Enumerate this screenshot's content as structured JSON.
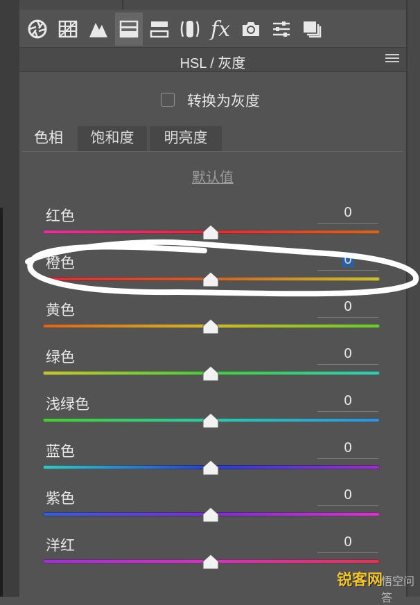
{
  "header": {
    "title": "HSL / 灰度"
  },
  "toolbar": {
    "tools": [
      {
        "icon": "aperture-icon"
      },
      {
        "icon": "grid-icon"
      },
      {
        "icon": "mountain-icon"
      },
      {
        "icon": "hsl-icon",
        "active": true
      },
      {
        "icon": "split-tone-icon"
      },
      {
        "icon": "lens-icon"
      },
      {
        "icon": "fx-icon",
        "label": "fx"
      },
      {
        "icon": "camera-icon"
      },
      {
        "icon": "sliders-icon"
      },
      {
        "icon": "presets-icon"
      }
    ]
  },
  "grayscale": {
    "label": "转换为灰度",
    "checked": false
  },
  "tabs": [
    {
      "label": "色相",
      "active": true
    },
    {
      "label": "饱和度",
      "active": false
    },
    {
      "label": "明亮度",
      "active": false
    }
  ],
  "default_link": "默认值",
  "sliders": [
    {
      "label": "红色",
      "value": "0",
      "gradient": [
        "#d43a9a",
        "#d2323f",
        "#c96a2a"
      ]
    },
    {
      "label": "橙色",
      "value": "0",
      "gradient": [
        "#d03040",
        "#c8642c",
        "#c7c23a"
      ],
      "selected": true
    },
    {
      "label": "黄色",
      "value": "0",
      "gradient": [
        "#cf6a2c",
        "#c9b63a",
        "#6ec43c"
      ]
    },
    {
      "label": "绿色",
      "value": "0",
      "gradient": [
        "#c6c23a",
        "#4ec446",
        "#3cc4b4"
      ]
    },
    {
      "label": "浅绿色",
      "value": "0",
      "gradient": [
        "#52c43e",
        "#3cc0a8",
        "#3c8ed2"
      ]
    },
    {
      "label": "蓝色",
      "value": "0",
      "gradient": [
        "#3cc2bc",
        "#2a40cc",
        "#9a32c4"
      ]
    },
    {
      "label": "紫色",
      "value": "0",
      "gradient": [
        "#3a5ed2",
        "#7a32c8",
        "#cc3cc0"
      ]
    },
    {
      "label": "洋红",
      "value": "0",
      "gradient": [
        "#9a34cc",
        "#cc38b8",
        "#d43a56"
      ]
    }
  ],
  "watermark": {
    "text": "锐客网",
    "text2": "悟空问答"
  },
  "colors": {
    "panel": "#535353",
    "header": "#4a4a4a",
    "accent": "#2d5e9e"
  }
}
